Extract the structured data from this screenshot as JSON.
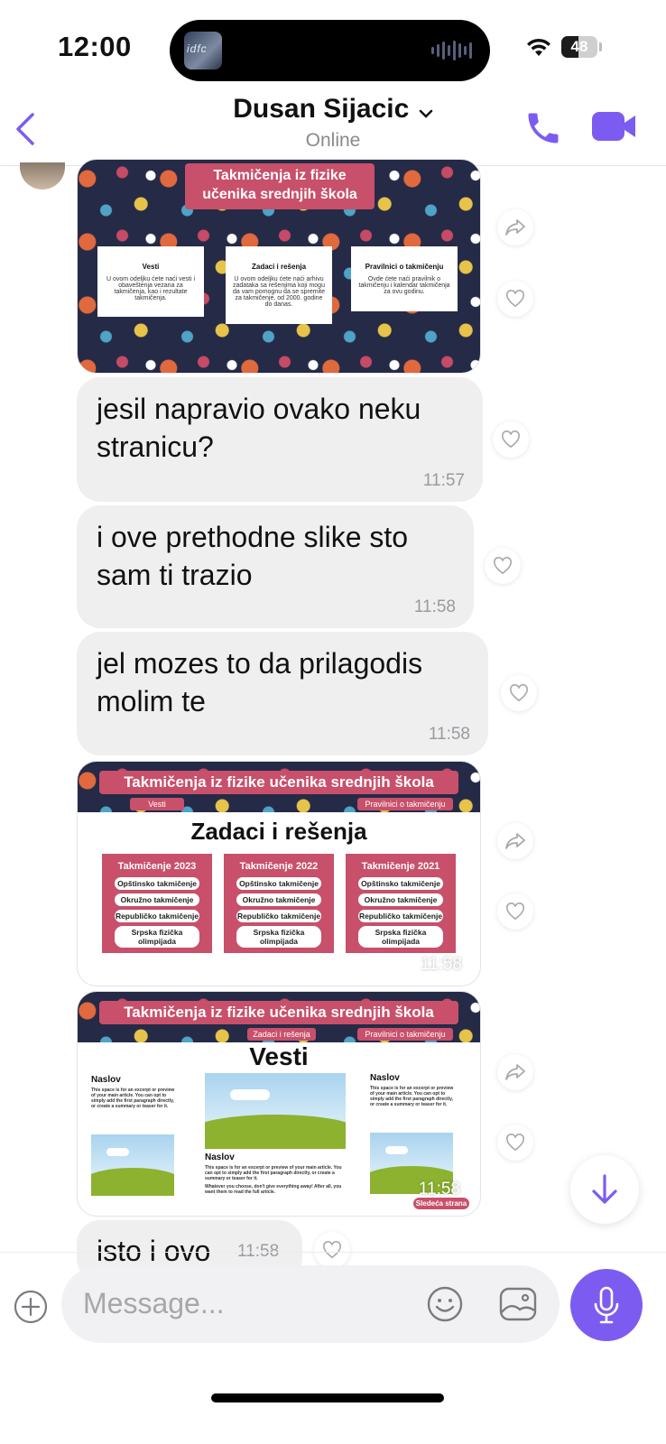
{
  "status_bar": {
    "time": "12:00",
    "island_art_text": "idfc",
    "battery": "48",
    "battery_level": 0.48
  },
  "header": {
    "contact_name": "Dusan Sijacic",
    "status": "Online"
  },
  "colors": {
    "accent": "#7c5cf0",
    "bubble": "#efeff0",
    "pink": "#c8506a",
    "navy": "#252a47"
  },
  "messages": [
    {
      "type": "image",
      "image": {
        "title_line1": "Takmičenja iz fizike",
        "title_line2": "učenika srednjih škola",
        "cards": [
          {
            "title": "Vesti",
            "body": "U ovom odeljku ćete naći vesti i obaveštenja vezana za takmičenja, kao i rezultate takmičenja."
          },
          {
            "title": "Zadaci i rešenja",
            "body": "U ovom odeljku ćete naći arhivu zadataka sa rešenjima koji mogu da vam pomognu da se spremite za takmičenje, od 2000. godine do danas."
          },
          {
            "title": "Pravilnici o takmičenju",
            "body": "Ovde ćete naći pravilnik o takmičenju i kalendar takmičenja za ovu godinu."
          }
        ]
      }
    },
    {
      "type": "text",
      "text_line1": "jesil napravio ovako neku",
      "text_line2": "stranicu?",
      "time": "11:57"
    },
    {
      "type": "text",
      "text_line1": "i ove prethodne slike sto",
      "text_line2": "sam ti trazio",
      "time": "11:58"
    },
    {
      "type": "text",
      "text_line1": "jel mozes to da prilagodis",
      "text_line2": "molim te",
      "time": "11:58"
    },
    {
      "type": "image",
      "time": "11:58",
      "image": {
        "banner": "Takmičenja iz fizike učenika srednjih škola",
        "nav_left": "Vesti",
        "nav_right": "Pravilnici o takmičenju",
        "heading": "Zadaci i rešenja",
        "columns": [
          {
            "title": "Takmičenje 2023",
            "items": [
              "Opštinsko takmičenje",
              "Okružno takmičenje",
              "Republičko takmičenje",
              "Srpska fizička olimpijada"
            ]
          },
          {
            "title": "Takmičenje 2022",
            "items": [
              "Opštinsko takmičenje",
              "Okružno takmičenje",
              "Republičko takmičenje",
              "Srpska fizička olimpijada"
            ]
          },
          {
            "title": "Takmičenje 2021",
            "items": [
              "Opštinsko takmičenje",
              "Okružno takmičenje",
              "Republičko takmičenje",
              "Srpska fizička olimpijada"
            ]
          }
        ]
      }
    },
    {
      "type": "image",
      "time": "11:58",
      "image": {
        "banner": "Takmičenja iz fizike učenika srednjih škola",
        "nav_left": "Zadaci i rešenja",
        "nav_right": "Pravilnici o takmičenju",
        "heading": "Vesti",
        "article_title": "Naslov",
        "article_body": "This space is for an excerpt or preview of your main article. You can opt to simply add the first paragraph directly, or create a summary or teaser for it.",
        "article_body2": "Whatever you choose, don't give everything away! After all, you want them to read the full article.",
        "next_button": "Sledeća strana"
      }
    },
    {
      "type": "text",
      "text": "isto i ovo",
      "time": "11:58"
    }
  ],
  "composer": {
    "placeholder": "Message..."
  }
}
